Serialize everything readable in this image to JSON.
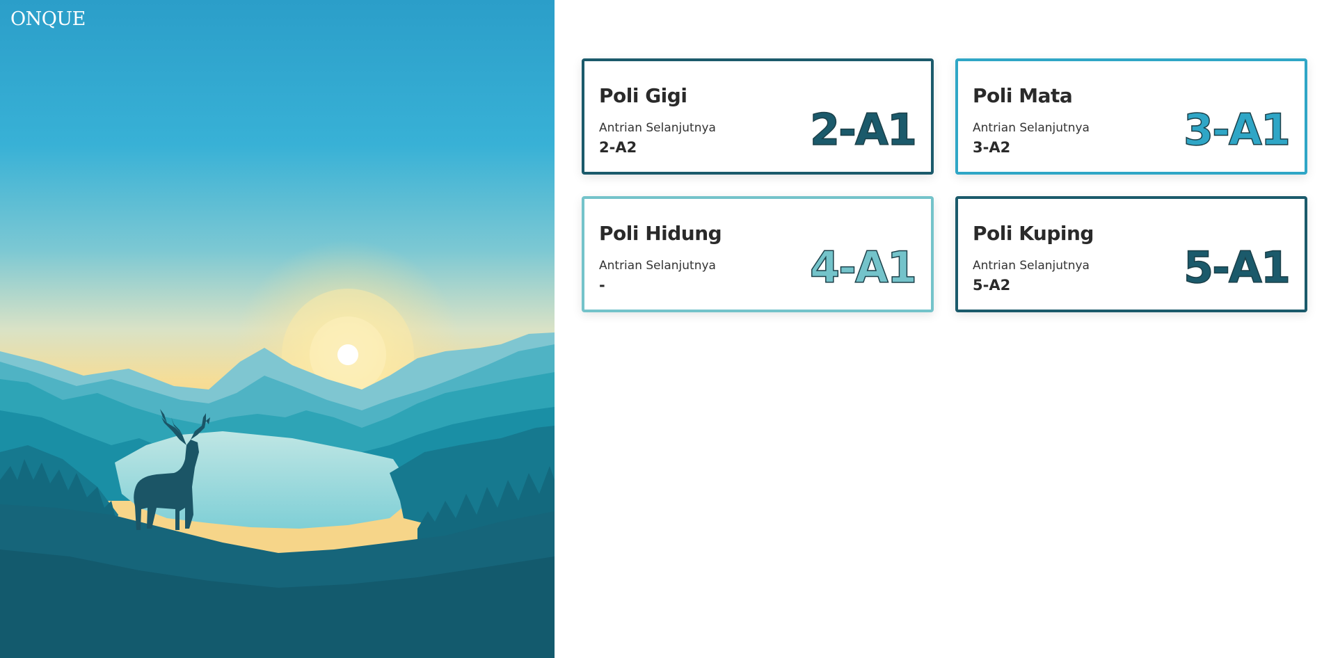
{
  "app": {
    "brand": "ONQUE"
  },
  "cards": [
    {
      "name": "Poli Gigi",
      "next_label": "Antrian Selanjutnya",
      "next_value": "2-A2",
      "current": "2-A1",
      "color": "#1b5a6b"
    },
    {
      "name": "Poli Mata",
      "next_label": "Antrian Selanjutnya",
      "next_value": "3-A2",
      "current": "3-A1",
      "color": "#2fa6c6"
    },
    {
      "name": "Poli Hidung",
      "next_label": "Antrian Selanjutnya",
      "next_value": "-",
      "current": "4-A1",
      "color": "#74c3ca"
    },
    {
      "name": "Poli Kuping",
      "next_label": "Antrian Selanjutnya",
      "next_value": "5-A2",
      "current": "5-A1",
      "color": "#1b5a6b"
    }
  ]
}
